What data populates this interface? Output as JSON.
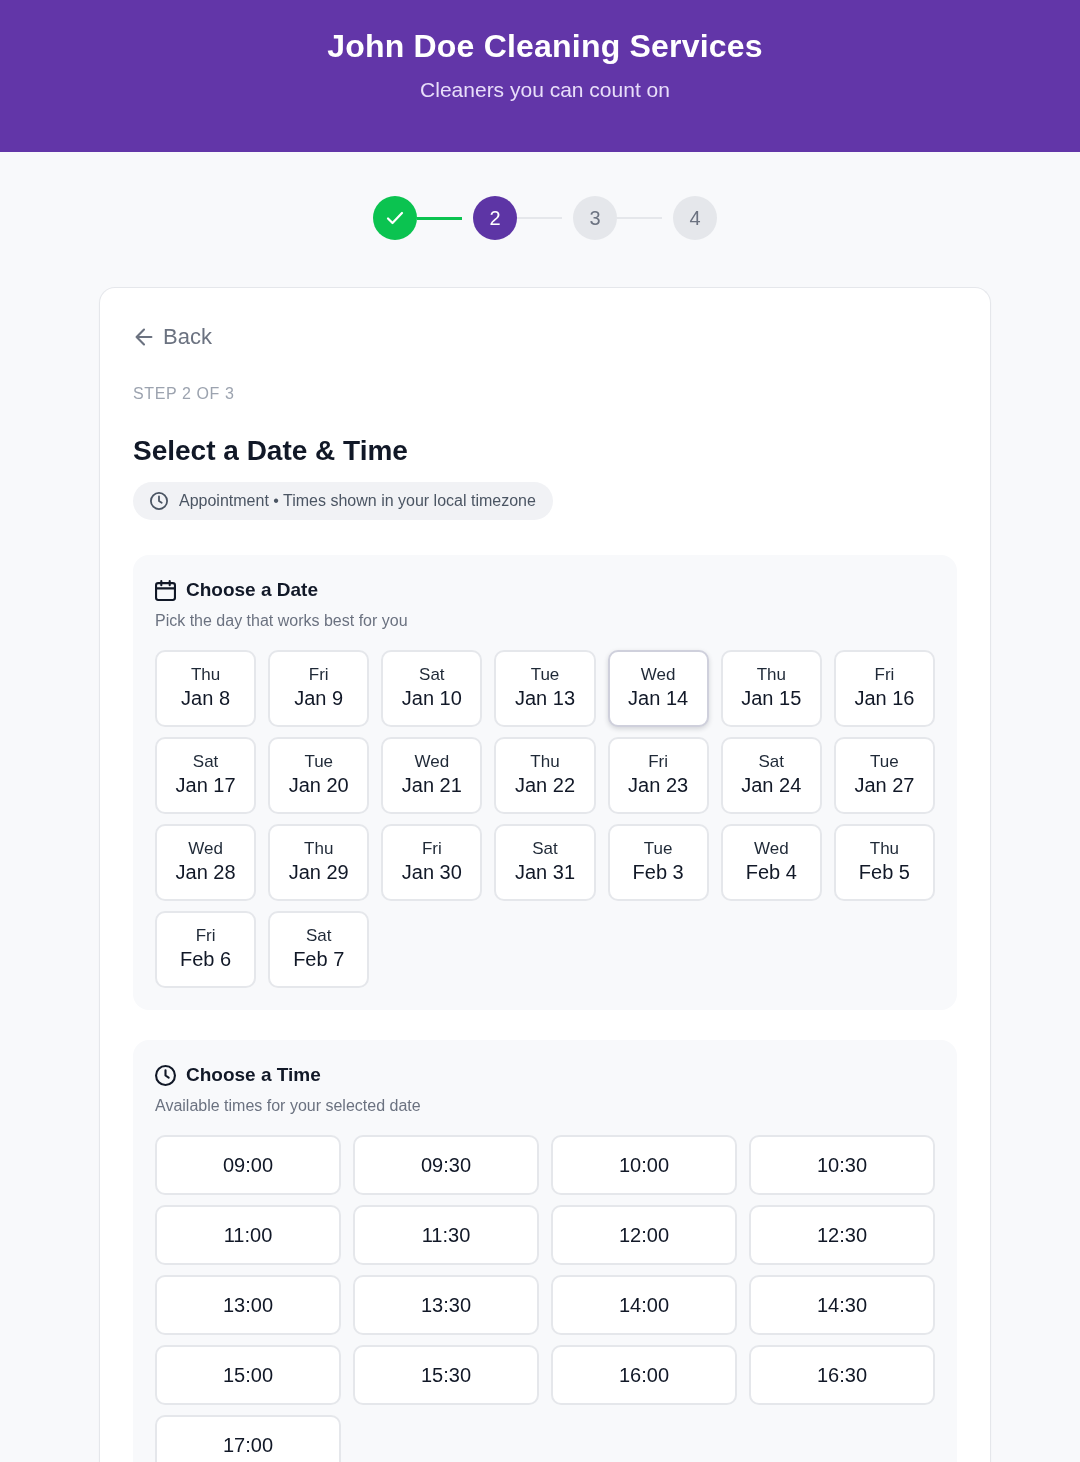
{
  "header": {
    "title": "John Doe Cleaning Services",
    "tagline": "Cleaners you can count on"
  },
  "steps": [
    {
      "kind": "done"
    },
    {
      "kind": "current",
      "label": "2"
    },
    {
      "kind": "upcoming",
      "label": "3"
    },
    {
      "kind": "upcoming",
      "label": "4"
    }
  ],
  "card": {
    "back_link": "Back",
    "step_caption": "STEP 2 OF 3",
    "title": "Select a Date & Time",
    "info_pill": "Appointment • Times shown in your local timezone"
  },
  "date_section": {
    "title": "Choose a Date",
    "subtitle": "Pick the day that works best for you",
    "dates": [
      {
        "weekday": "Thu",
        "date": "Jan 8",
        "selected": false
      },
      {
        "weekday": "Fri",
        "date": "Jan 9",
        "selected": false
      },
      {
        "weekday": "Sat",
        "date": "Jan 10",
        "selected": false
      },
      {
        "weekday": "Tue",
        "date": "Jan 13",
        "selected": false
      },
      {
        "weekday": "Wed",
        "date": "Jan 14",
        "selected": true
      },
      {
        "weekday": "Thu",
        "date": "Jan 15",
        "selected": false
      },
      {
        "weekday": "Fri",
        "date": "Jan 16",
        "selected": false
      },
      {
        "weekday": "Sat",
        "date": "Jan 17",
        "selected": false
      },
      {
        "weekday": "Tue",
        "date": "Jan 20",
        "selected": false
      },
      {
        "weekday": "Wed",
        "date": "Jan 21",
        "selected": false
      },
      {
        "weekday": "Thu",
        "date": "Jan 22",
        "selected": false
      },
      {
        "weekday": "Fri",
        "date": "Jan 23",
        "selected": false
      },
      {
        "weekday": "Sat",
        "date": "Jan 24",
        "selected": false
      },
      {
        "weekday": "Tue",
        "date": "Jan 27",
        "selected": false
      },
      {
        "weekday": "Wed",
        "date": "Jan 28",
        "selected": false
      },
      {
        "weekday": "Thu",
        "date": "Jan 29",
        "selected": false
      },
      {
        "weekday": "Fri",
        "date": "Jan 30",
        "selected": false
      },
      {
        "weekday": "Sat",
        "date": "Jan 31",
        "selected": false
      },
      {
        "weekday": "Tue",
        "date": "Feb 3",
        "selected": false
      },
      {
        "weekday": "Wed",
        "date": "Feb 4",
        "selected": false
      },
      {
        "weekday": "Thu",
        "date": "Feb 5",
        "selected": false
      },
      {
        "weekday": "Fri",
        "date": "Feb 6",
        "selected": false
      },
      {
        "weekday": "Sat",
        "date": "Feb 7",
        "selected": false
      }
    ]
  },
  "time_section": {
    "title": "Choose a Time",
    "subtitle": "Available times for your selected date",
    "times": [
      {
        "label": "09:00",
        "selected": false
      },
      {
        "label": "09:30",
        "selected": false
      },
      {
        "label": "10:00",
        "selected": false
      },
      {
        "label": "10:30",
        "selected": false
      },
      {
        "label": "11:00",
        "selected": false
      },
      {
        "label": "11:30",
        "selected": false
      },
      {
        "label": "12:00",
        "selected": false
      },
      {
        "label": "12:30",
        "selected": false
      },
      {
        "label": "13:00",
        "selected": false
      },
      {
        "label": "13:30",
        "selected": false
      },
      {
        "label": "14:00",
        "selected": false
      },
      {
        "label": "14:30",
        "selected": false
      },
      {
        "label": "15:00",
        "selected": false
      },
      {
        "label": "15:30",
        "selected": false
      },
      {
        "label": "16:00",
        "selected": false
      },
      {
        "label": "16:30",
        "selected": false
      },
      {
        "label": "17:00",
        "selected": false
      }
    ]
  }
}
